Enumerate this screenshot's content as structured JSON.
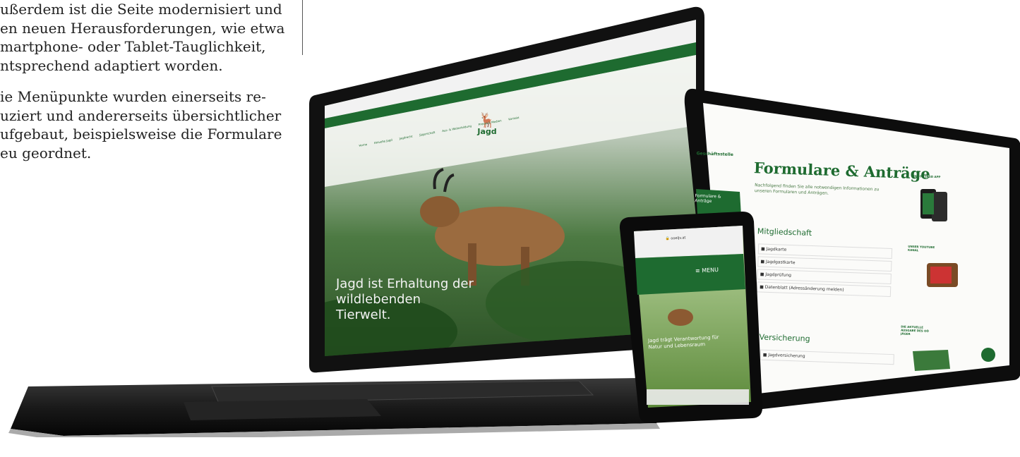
{
  "article": {
    "paragraph1": [
      "ußerdem ist die Seite modernisiert und",
      "en neuen Herausforderungen, wie etwa",
      "martphone- oder Tablet-Tauglichkeit,",
      "ntsprechend adaptiert worden."
    ],
    "paragraph2": [
      "ie Menüpunkte wurden einerseits re-",
      "uziert und andererseits übersichtlicher",
      "ufgebaut, beispielsweise die Formulare",
      "eu geordnet."
    ]
  },
  "laptop_screen": {
    "logo_text": "Jagd",
    "nav_items": [
      "Home",
      "Aktuelle Jagd",
      "Jagdrecht",
      "Jägerschaft",
      "Aus- & Weiterbildung",
      "Presse & Medien",
      "Kontakt"
    ],
    "hero_caption_line1": "Jagd ist Erhaltung der",
    "hero_caption_line2": "wildlebenden Tierwelt."
  },
  "tablet_screen": {
    "sidebar_label1": "Geschäftsstelle",
    "sidebar_active": "Formulare & Anträge",
    "title": "Formulare & Anträge",
    "intro": "Nachfolgend finden Sie alle notwendigen Informationen zu unseren Formularen und Anträgen.",
    "section1": "Mitgliedschaft",
    "section1_items": [
      "Jagdkarte",
      "Jagdgastkarte",
      "Jagdprüfung",
      "Datenblatt (Adressänderung melden)"
    ],
    "section2": "Versicherung",
    "section2_items": [
      "Jagdversicherung"
    ],
    "aside_app": "DIE OÖ JAGD APP",
    "aside_youtube": "UNSER YOUTUBE KANAL",
    "aside_issue": "DIE AKTUELLE AUSGABE DES OÖ JÄGER"
  },
  "phone_screen": {
    "url": "ooeljv.at",
    "menu_label": "MENU",
    "caption": "Jagd trägt Verantwortung für Natur und Lebensraum"
  },
  "colors": {
    "brand_green": "#1e6b30",
    "dark_green": "#0f4a1e"
  }
}
